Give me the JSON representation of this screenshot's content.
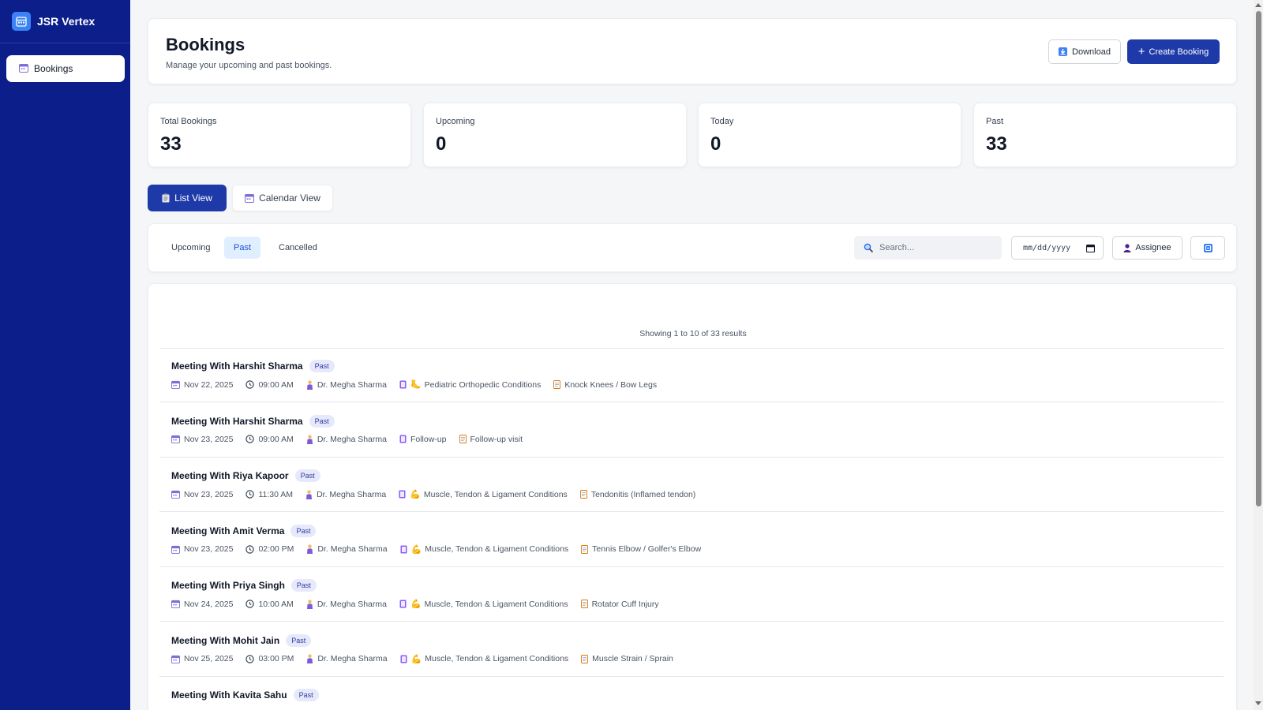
{
  "app": {
    "title": "JSR Vertex"
  },
  "sidebar": {
    "items": [
      {
        "label": "Bookings",
        "icon": "calendar-icon"
      }
    ]
  },
  "header": {
    "title": "Bookings",
    "subtitle": "Manage your upcoming and past bookings.",
    "download_label": "Download",
    "create_label": "Create Booking"
  },
  "stats": [
    {
      "label": "Total Bookings",
      "value": "33"
    },
    {
      "label": "Upcoming",
      "value": "0"
    },
    {
      "label": "Today",
      "value": "0"
    },
    {
      "label": "Past",
      "value": "33"
    }
  ],
  "views": {
    "list_label": "List View",
    "calendar_label": "Calendar View",
    "active": "list"
  },
  "filters": {
    "tabs": [
      {
        "label": "Upcoming"
      },
      {
        "label": "Past"
      },
      {
        "label": "Cancelled"
      }
    ],
    "active_tab": "Past",
    "search_placeholder": "Search...",
    "date_placeholder": "mm/dd/yyyy",
    "assignee_label": "Assignee"
  },
  "results": {
    "info": "Showing 1 to 10 of 33 results"
  },
  "bookings": [
    {
      "title": "Meeting With Harshit Sharma",
      "status": "Past",
      "date": "Nov 22, 2025",
      "time": "09:00 AM",
      "assignee": "Dr. Megha Sharma",
      "category_emoji": "🦶",
      "category": "Pediatric Orthopedic Conditions",
      "note": "Knock Knees / Bow Legs"
    },
    {
      "title": "Meeting With Harshit Sharma",
      "status": "Past",
      "date": "Nov 23, 2025",
      "time": "09:00 AM",
      "assignee": "Dr. Megha Sharma",
      "category_emoji": "",
      "category": "Follow-up",
      "note": "Follow-up visit"
    },
    {
      "title": "Meeting With Riya Kapoor",
      "status": "Past",
      "date": "Nov 23, 2025",
      "time": "11:30 AM",
      "assignee": "Dr. Megha Sharma",
      "category_emoji": "💪",
      "category": "Muscle, Tendon & Ligament Conditions",
      "note": "Tendonitis (Inflamed tendon)"
    },
    {
      "title": "Meeting With Amit Verma",
      "status": "Past",
      "date": "Nov 23, 2025",
      "time": "02:00 PM",
      "assignee": "Dr. Megha Sharma",
      "category_emoji": "💪",
      "category": "Muscle, Tendon & Ligament Conditions",
      "note": "Tennis Elbow / Golfer's Elbow"
    },
    {
      "title": "Meeting With Priya Singh",
      "status": "Past",
      "date": "Nov 24, 2025",
      "time": "10:00 AM",
      "assignee": "Dr. Megha Sharma",
      "category_emoji": "💪",
      "category": "Muscle, Tendon & Ligament Conditions",
      "note": "Rotator Cuff Injury"
    },
    {
      "title": "Meeting With Mohit Jain",
      "status": "Past",
      "date": "Nov 25, 2025",
      "time": "03:00 PM",
      "assignee": "Dr. Megha Sharma",
      "category_emoji": "💪",
      "category": "Muscle, Tendon & Ligament Conditions",
      "note": "Muscle Strain / Sprain"
    },
    {
      "title": "Meeting With Kavita Sahu",
      "status": "Past",
      "date": "",
      "time": "",
      "assignee": "",
      "category_emoji": "",
      "category": "",
      "note": ""
    }
  ],
  "colors": {
    "sidebar": "#0b1e8a",
    "primary": "#1e3aa8",
    "badge_bg": "#e6e9fb",
    "badge_text": "#2f3a9e",
    "active_tab_bg": "#e0efff"
  }
}
